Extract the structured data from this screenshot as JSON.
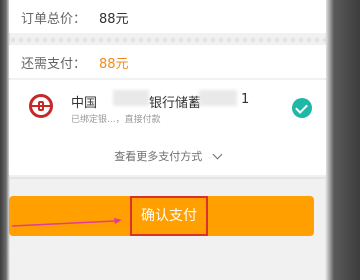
{
  "order": {
    "total_label": "订单总价：",
    "total_value": "88元",
    "due_label": "还需支付：",
    "due_value": "88元"
  },
  "payment": {
    "bank_name_part1": "中国",
    "bank_name_part2": "银行储蓄",
    "bank_name_part3": "1",
    "bank_sub": "已绑定银...，直接付款",
    "more_methods": "查看更多支付方式"
  },
  "actions": {
    "confirm_label": "确认支付"
  },
  "colors": {
    "accent": "#ff9f00",
    "check": "#1fb7a6",
    "highlight": "#d9312b",
    "arrow": "#e33b9a"
  }
}
